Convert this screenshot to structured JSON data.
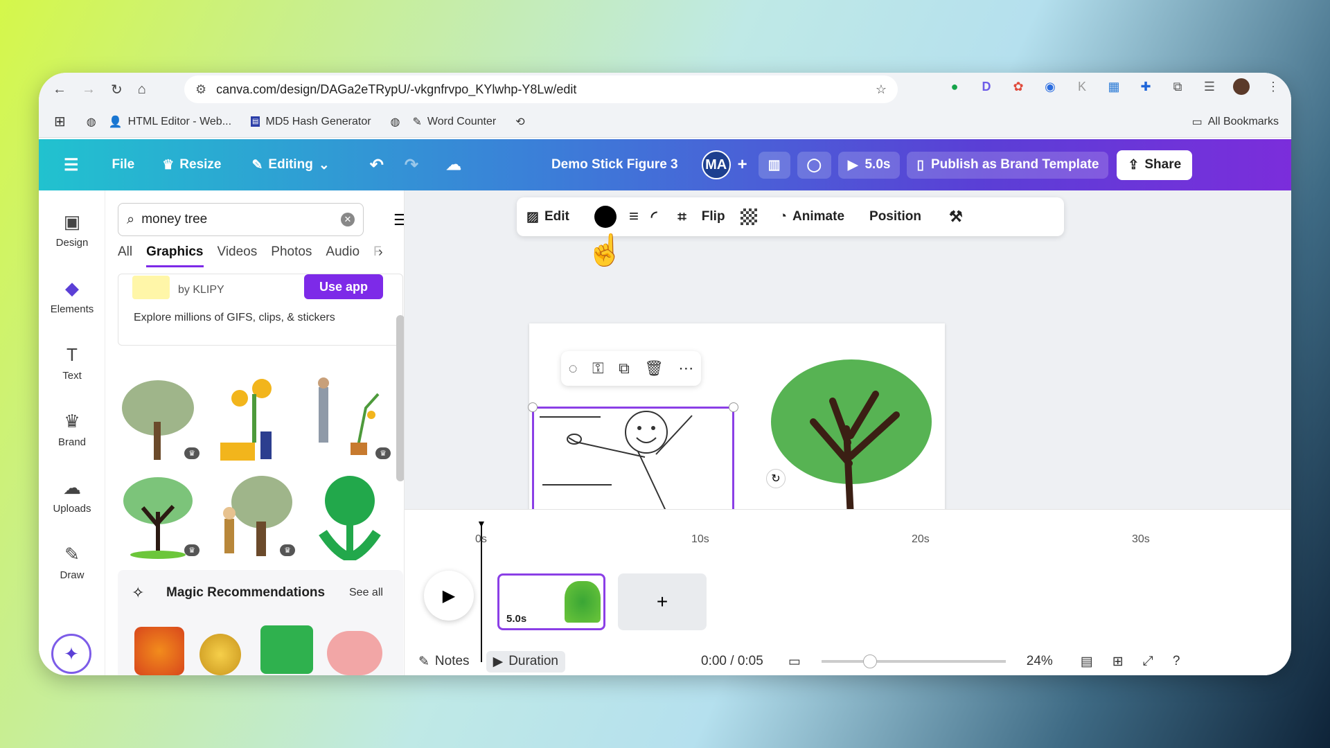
{
  "browser": {
    "url": "canva.com/design/DAGa2eTRypU/-vkgnfrvpo_KYlwhp-Y8Lw/edit",
    "bookmarks": [
      "HTML Editor - Web...",
      "MD5 Hash Generator",
      "Word Counter"
    ],
    "all_bookmarks": "All Bookmarks"
  },
  "topbar": {
    "file": "File",
    "resize": "Resize",
    "editing": "Editing",
    "title": "Demo Stick Figure 3",
    "avatar": "MA",
    "play_time": "5.0s",
    "publish": "Publish as Brand Template",
    "share": "Share"
  },
  "sidebar": {
    "items": [
      {
        "label": "Design"
      },
      {
        "label": "Elements"
      },
      {
        "label": "Text"
      },
      {
        "label": "Brand"
      },
      {
        "label": "Uploads"
      },
      {
        "label": "Draw"
      }
    ]
  },
  "panel": {
    "search_value": "money tree",
    "tabs": [
      "All",
      "Graphics",
      "Videos",
      "Photos",
      "Audio",
      "F"
    ],
    "klipy_by": "by KLIPY",
    "klipy_cta": "Use app",
    "klipy_desc": "Explore millions of GIFS, clips, & stickers",
    "magic_title": "Magic Recommendations",
    "magic_see_all": "See all"
  },
  "toolbar": {
    "edit": "Edit",
    "flip": "Flip",
    "animate": "Animate",
    "position": "Position"
  },
  "timeline": {
    "ticks": [
      "0s",
      "10s",
      "20s",
      "30s"
    ],
    "clip_duration": "5.0s",
    "notes": "Notes",
    "duration": "Duration",
    "time": "0:00 / 0:05",
    "zoom": "24%"
  },
  "colors": {
    "accent": "#7d2ae8",
    "money_green": "#3aa635"
  }
}
